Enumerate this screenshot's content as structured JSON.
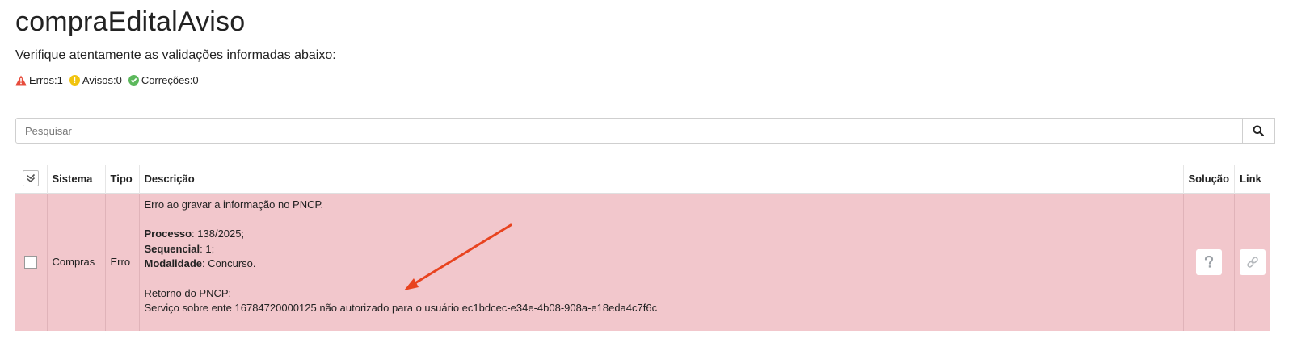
{
  "page": {
    "title": "compraEditalAviso",
    "subtitle": "Verifique atentamente as validações informadas abaixo:"
  },
  "counters": {
    "errors_label": "Erros:1",
    "warnings_label": "Avisos:0",
    "fixes_label": "Correções:0",
    "colors": {
      "error": "#e74c3c",
      "warning": "#f1c40f",
      "fix": "#5cb85c"
    }
  },
  "search": {
    "placeholder": "Pesquisar",
    "value": ""
  },
  "table": {
    "headers": {
      "sistema": "Sistema",
      "tipo": "Tipo",
      "descricao": "Descrição",
      "solucao": "Solução",
      "link": "Link"
    },
    "rows": [
      {
        "sistema": "Compras",
        "tipo": "Erro",
        "checked": false,
        "row_color": "#f2c7cc",
        "descricao": {
          "line1": "Erro ao gravar a informação no PNCP.",
          "processo_label": "Processo",
          "processo_value": ": 138/2025;",
          "sequencial_label": "Sequencial",
          "sequencial_value": ": 1;",
          "modalidade_label": "Modalidade",
          "modalidade_value": ": Concurso.",
          "retorno_label": "Retorno do PNCP:",
          "retorno_text": "Serviço sobre ente 16784720000125 não autorizado para o usuário ec1bdcec-e34e-4b08-908a-e18eda4c7f6c"
        },
        "solucao_icon": "question-icon",
        "link_icon": "link-icon"
      }
    ]
  },
  "annotation": {
    "icon": "red-arrow",
    "color": "#e8431f"
  }
}
